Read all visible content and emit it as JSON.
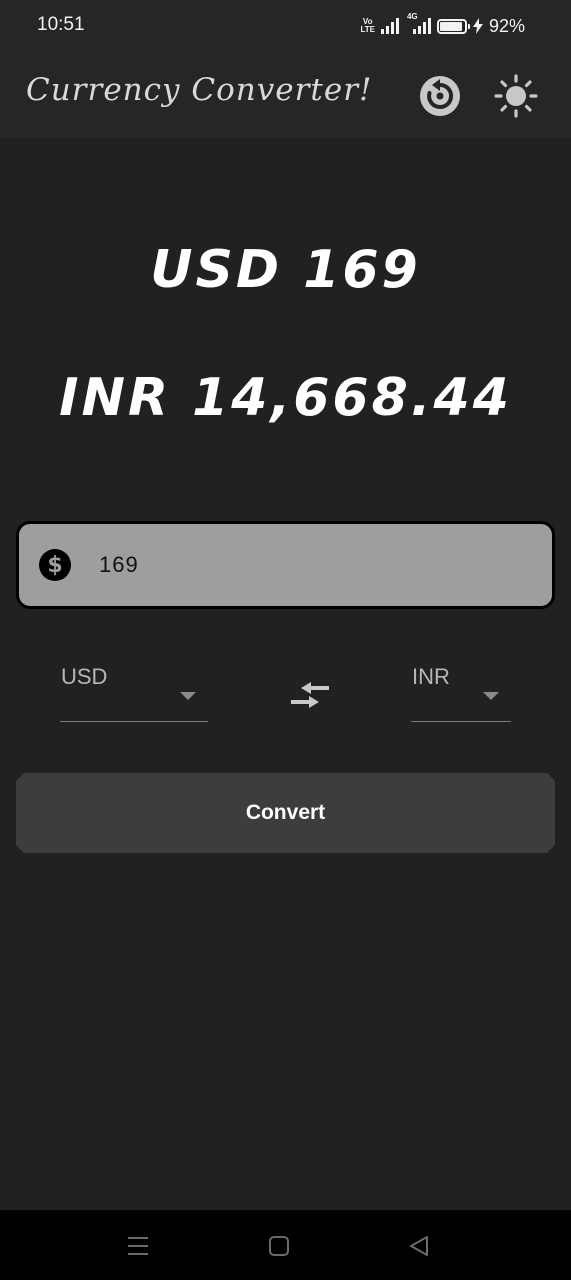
{
  "status_bar": {
    "time": "10:51",
    "volte_top": "Vo",
    "volte_bottom": "LTE",
    "network": "4G",
    "battery_level": 0.92,
    "battery_text": "92%"
  },
  "app_bar": {
    "title": "Currency Converter!",
    "refresh_icon": "refresh-icon",
    "theme_icon": "sun-icon"
  },
  "result": {
    "from_text": "USD 169",
    "to_text": "INR 14,668.44"
  },
  "amount": {
    "icon": "dollar-icon",
    "icon_glyph": "$",
    "value": "169"
  },
  "from_currency": {
    "selected": "USD"
  },
  "to_currency": {
    "selected": "INR"
  },
  "swap_icon": "swap-arrows-icon",
  "convert_button": {
    "label": "Convert"
  },
  "colors": {
    "background": "#212121",
    "app_bar": "#262528",
    "input_fill": "#9e9e9e",
    "button_fill": "#3d3d3d"
  }
}
